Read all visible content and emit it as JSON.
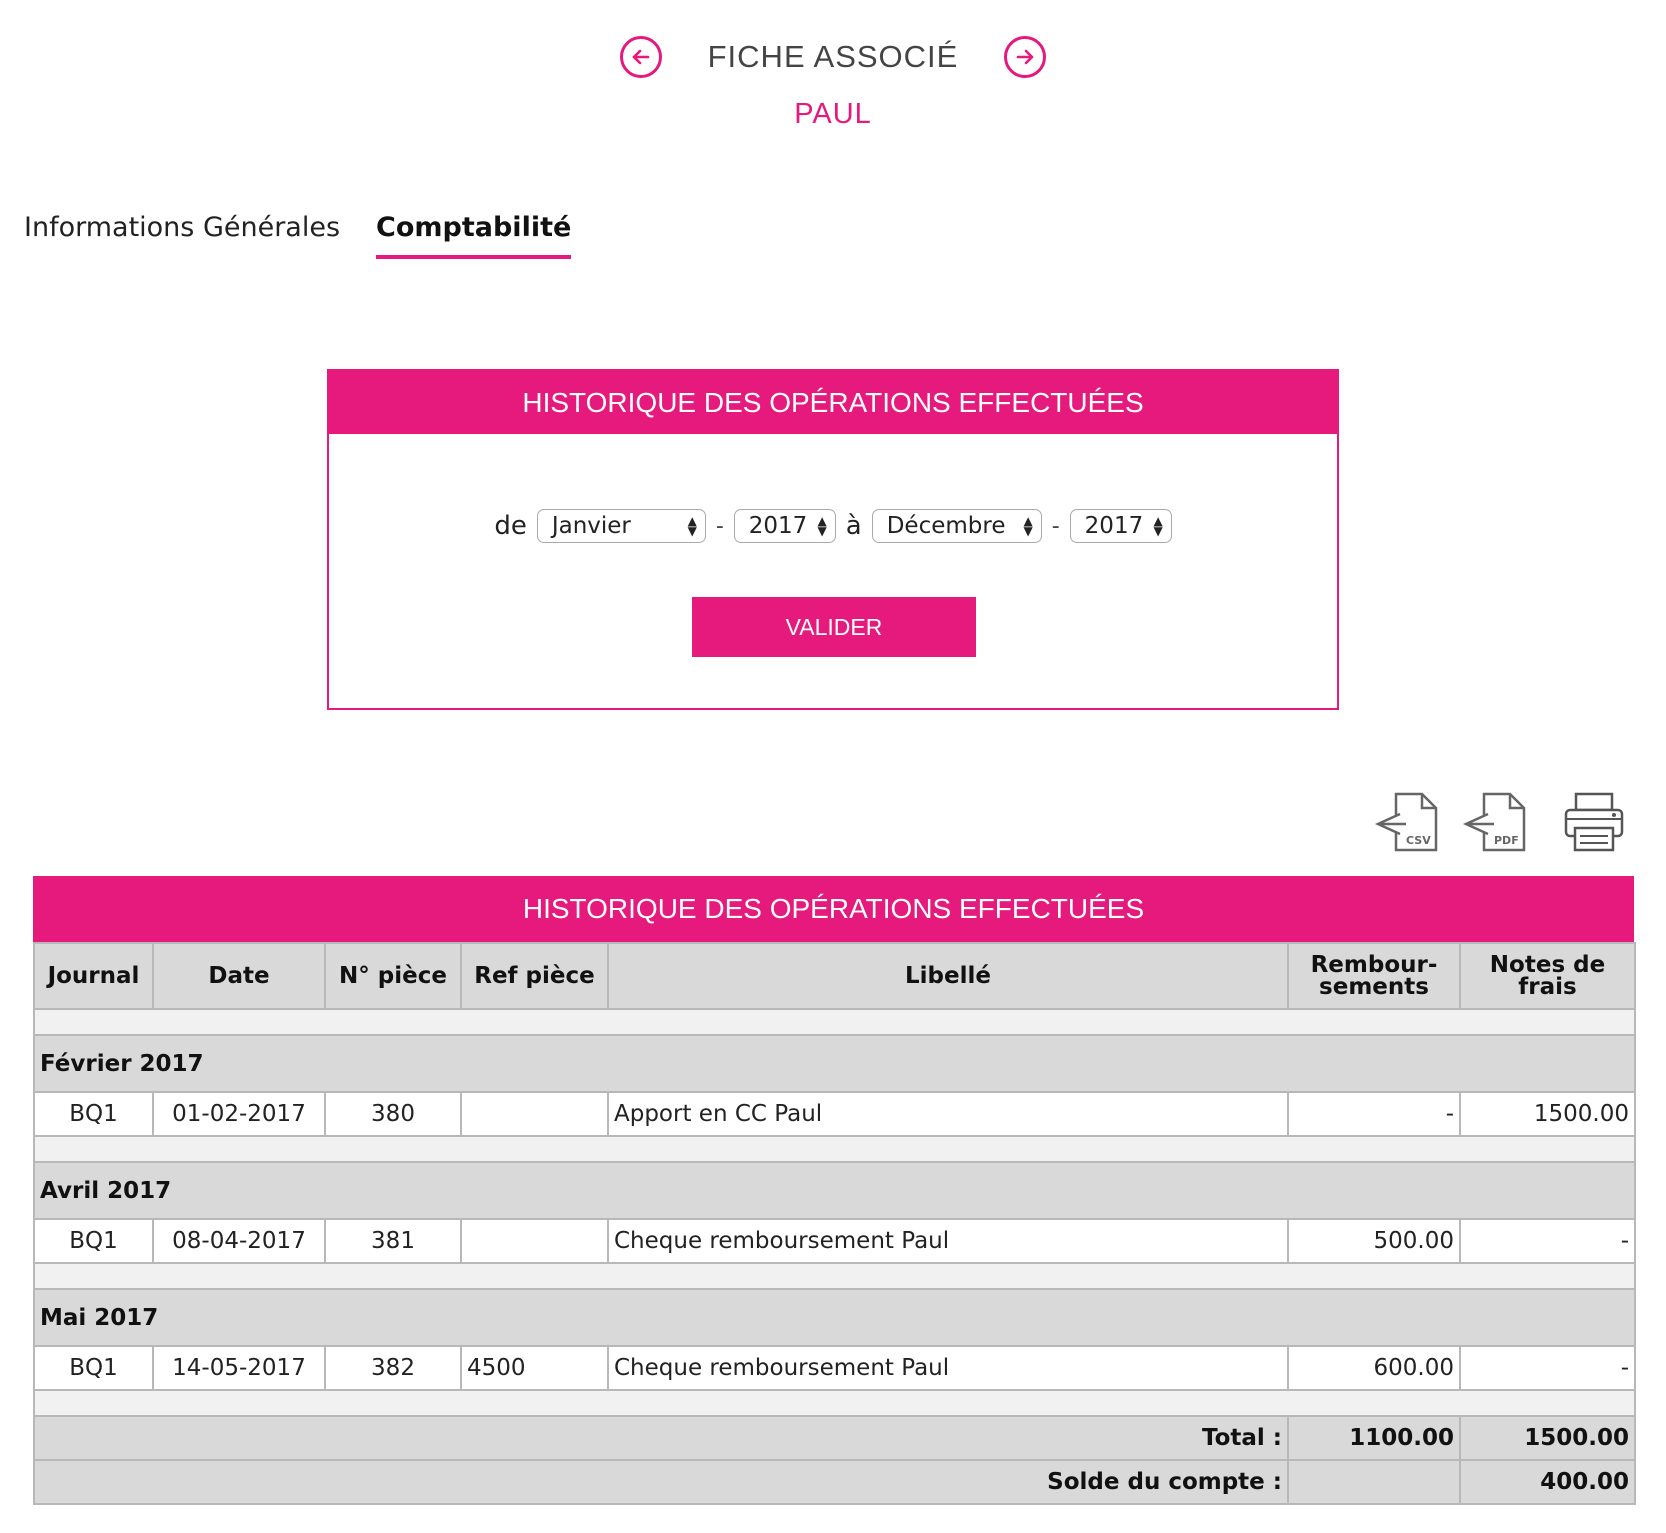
{
  "header": {
    "title": "FICHE ASSOCIÉ",
    "name": "PAUL"
  },
  "tabs": [
    {
      "label": "Informations Générales",
      "active": false
    },
    {
      "label": "Comptabilité",
      "active": true
    }
  ],
  "filter": {
    "title": "HISTORIQUE DES OPÉRATIONS EFFECTUÉES",
    "from_label": "de",
    "to_label": "à",
    "separator": "-",
    "from_month": "Janvier",
    "from_year": "2017",
    "to_month": "Décembre",
    "to_year": "2017",
    "button": "VALIDER"
  },
  "exports": {
    "csv": "CSV",
    "pdf": "PDF"
  },
  "table": {
    "title": "HISTORIQUE DES OPÉRATIONS EFFECTUÉES",
    "columns": [
      "Journal",
      "Date",
      "N° pièce",
      "Ref pièce",
      "Libellé",
      "Rembour-\nsements",
      "Notes de\nfrais"
    ],
    "groups": [
      {
        "month": "Février 2017",
        "rows": [
          {
            "journal": "BQ1",
            "date": "01-02-2017",
            "piece": "380",
            "ref": "",
            "libelle": "Apport en CC Paul",
            "remboursements": "-",
            "notes": "1500.00"
          }
        ]
      },
      {
        "month": "Avril 2017",
        "rows": [
          {
            "journal": "BQ1",
            "date": "08-04-2017",
            "piece": "381",
            "ref": "",
            "libelle": "Cheque remboursement Paul",
            "remboursements": "500.00",
            "notes": "-"
          }
        ]
      },
      {
        "month": "Mai 2017",
        "rows": [
          {
            "journal": "BQ1",
            "date": "14-05-2017",
            "piece": "382",
            "ref": "4500",
            "libelle": "Cheque remboursement Paul",
            "remboursements": "600.00",
            "notes": "-"
          }
        ]
      }
    ],
    "total_label": "Total :",
    "total_remboursements": "1100.00",
    "total_notes": "1500.00",
    "solde_label": "Solde du compte :",
    "solde_remboursements": "",
    "solde_notes": "400.00"
  },
  "colors": {
    "accent": "#e6197d",
    "header_gray": "#d9d9d9",
    "spacer_gray": "#f1f1f1"
  }
}
